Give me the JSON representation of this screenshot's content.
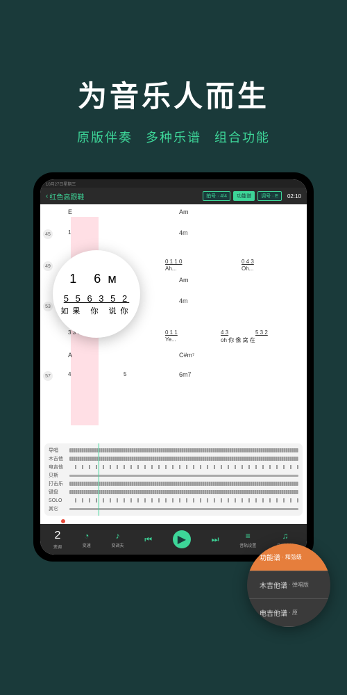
{
  "hero": {
    "title": "为音乐人而生",
    "sub1": "原版伴奏",
    "sub2": "多种乐谱",
    "sub3": "组合功能"
  },
  "topbar": {
    "status_time": "10月27日星期三",
    "back": "‹",
    "song": "红色高跟鞋",
    "badge1": "拍号 · 4/4",
    "badge2": "功能谱",
    "badge3": "调号 · E",
    "time": "02:10"
  },
  "chords": {
    "r1a": "E",
    "r1b": "Am",
    "r3b": "Am",
    "r4a": "4m",
    "r5a": "A",
    "r5b": "C#m⁷",
    "r4b": "4m",
    "r6b": "6m7"
  },
  "bars": {
    "b1": "45",
    "b2": "49",
    "b3": "53",
    "b4": "57"
  },
  "zoom": {
    "r1": "1   6ᴍ",
    "r2": "5 5  6  3 5 2",
    "r3": "如果 你 说你"
  },
  "score": {
    "l2a": "1",
    "l2b": "3  3  5·",
    "l3a": "Ah...",
    "l3b": "Oh...",
    "l4a": "0   1   1   0",
    "l4b": "0   4   3",
    "l5a": "4",
    "l5b": "5",
    "l6a": "0  1  1",
    "l6b": "4  3",
    "l6c": "5  3 2",
    "l7a": "Ye...",
    "l7b": "oh 你 像 窝 在"
  },
  "tracks": {
    "t1": "导唱",
    "t2": "木吉他",
    "t3": "电吉他",
    "t4": "贝斯",
    "t5": "打击乐",
    "t6": "键盘",
    "t7": "SOLO",
    "t8": "其它"
  },
  "controls": {
    "c1_val": "2",
    "c1": "变调",
    "c2": "变速",
    "c3": "变调夫",
    "c4": "音轨设置",
    "c5": "乐谱选择"
  },
  "popup": {
    "p1": "功能谱",
    "p1s": "· 和弦级",
    "p2": "木吉他谱",
    "p2s": "· 弹唱版",
    "p3": "电吉他谱",
    "p3s": "· 原"
  }
}
